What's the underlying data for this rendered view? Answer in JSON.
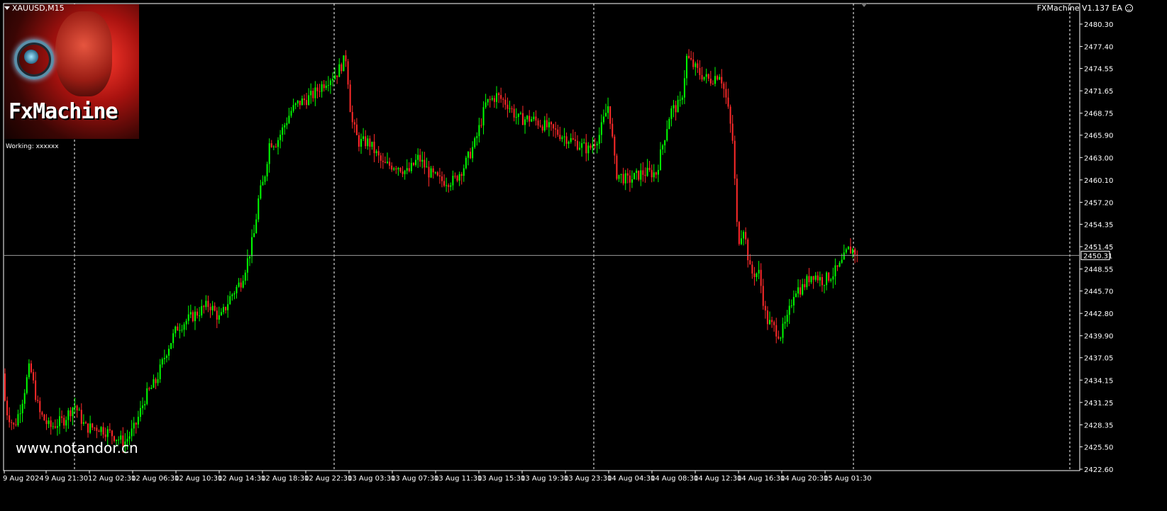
{
  "symbol": "XAUUSD,M15",
  "ea_name": "FXMachine V1.137 EA",
  "logo_text": "FxMachine",
  "working": "Working: xxxxxx",
  "watermark": "www.notandor.cn",
  "colors": {
    "background": "#000000",
    "up": "#00ff00",
    "down": "#ff2a2a",
    "grid": "#ffffff",
    "text": "#ffffff"
  },
  "chart_data": {
    "type": "candlestick",
    "current_price": 2450.31,
    "y_ticks": [
      "2480.30",
      "2477.40",
      "2474.55",
      "2471.65",
      "2468.75",
      "2465.90",
      "2463.00",
      "2460.10",
      "2457.20",
      "2454.35",
      "2451.45",
      "2448.55",
      "2445.70",
      "2442.80",
      "2439.90",
      "2437.05",
      "2434.15",
      "2431.25",
      "2428.35",
      "2425.50",
      "2422.60"
    ],
    "ylim": [
      2422.6,
      2480.3
    ],
    "x_ticks": [
      "9 Aug 2024",
      "9 Aug 21:30",
      "12 Aug 02:30",
      "12 Aug 06:30",
      "12 Aug 10:30",
      "12 Aug 14:30",
      "12 Aug 18:30",
      "12 Aug 22:30",
      "13 Aug 03:30",
      "13 Aug 07:30",
      "13 Aug 11:30",
      "13 Aug 15:30",
      "13 Aug 19:30",
      "13 Aug 23:30",
      "14 Aug 04:30",
      "14 Aug 08:30",
      "14 Aug 12:30",
      "14 Aug 16:30",
      "14 Aug 20:30",
      "15 Aug 01:30"
    ],
    "period_separators": [
      "9 Aug 21:30",
      "12 Aug 22:30",
      "13 Aug 23:30",
      "15 Aug 01:30"
    ],
    "price_path": [
      [
        0,
        2435
      ],
      [
        10,
        2430
      ],
      [
        20,
        2428
      ],
      [
        30,
        2431
      ],
      [
        42,
        2436
      ],
      [
        55,
        2430
      ],
      [
        70,
        2428
      ],
      [
        90,
        2429
      ],
      [
        105,
        2431
      ],
      [
        120,
        2428
      ],
      [
        140,
        2428
      ],
      [
        160,
        2427
      ],
      [
        175,
        2426
      ],
      [
        190,
        2428
      ],
      [
        205,
        2432
      ],
      [
        220,
        2434
      ],
      [
        235,
        2438
      ],
      [
        250,
        2441
      ],
      [
        265,
        2442
      ],
      [
        280,
        2443
      ],
      [
        295,
        2444
      ],
      [
        310,
        2442
      ],
      [
        325,
        2445
      ],
      [
        340,
        2447
      ],
      [
        350,
        2450
      ],
      [
        358,
        2453
      ],
      [
        365,
        2458
      ],
      [
        372,
        2460
      ],
      [
        380,
        2465
      ],
      [
        390,
        2465
      ],
      [
        400,
        2467
      ],
      [
        410,
        2469
      ],
      [
        420,
        2470
      ],
      [
        440,
        2471
      ],
      [
        460,
        2473
      ],
      [
        475,
        2474
      ],
      [
        488,
        2476
      ],
      [
        495,
        2468
      ],
      [
        505,
        2465
      ],
      [
        520,
        2465
      ],
      [
        540,
        2462
      ],
      [
        560,
        2462
      ],
      [
        575,
        2461
      ],
      [
        590,
        2463
      ],
      [
        605,
        2461
      ],
      [
        620,
        2460
      ],
      [
        640,
        2460
      ],
      [
        655,
        2462
      ],
      [
        670,
        2465
      ],
      [
        685,
        2470
      ],
      [
        700,
        2471
      ],
      [
        715,
        2470
      ],
      [
        730,
        2468
      ],
      [
        750,
        2468
      ],
      [
        770,
        2467
      ],
      [
        790,
        2466
      ],
      [
        810,
        2465
      ],
      [
        830,
        2464
      ],
      [
        845,
        2466
      ],
      [
        858,
        2470
      ],
      [
        868,
        2461
      ],
      [
        885,
        2460
      ],
      [
        905,
        2461
      ],
      [
        925,
        2461
      ],
      [
        935,
        2465
      ],
      [
        945,
        2469
      ],
      [
        960,
        2470
      ],
      [
        968,
        2476
      ],
      [
        985,
        2474
      ],
      [
        1000,
        2473
      ],
      [
        1015,
        2474
      ],
      [
        1025,
        2470
      ],
      [
        1033,
        2465
      ],
      [
        1040,
        2452
      ],
      [
        1048,
        2454
      ],
      [
        1058,
        2448
      ],
      [
        1070,
        2448
      ],
      [
        1080,
        2442
      ],
      [
        1090,
        2441
      ],
      [
        1100,
        2440
      ],
      [
        1110,
        2442
      ],
      [
        1120,
        2446
      ],
      [
        1130,
        2446
      ],
      [
        1145,
        2448
      ],
      [
        1160,
        2447
      ],
      [
        1175,
        2448
      ],
      [
        1185,
        2449
      ],
      [
        1195,
        2451
      ],
      [
        1203,
        2451
      ],
      [
        1210,
        2450.3
      ]
    ],
    "grid": false,
    "legend": "none"
  }
}
